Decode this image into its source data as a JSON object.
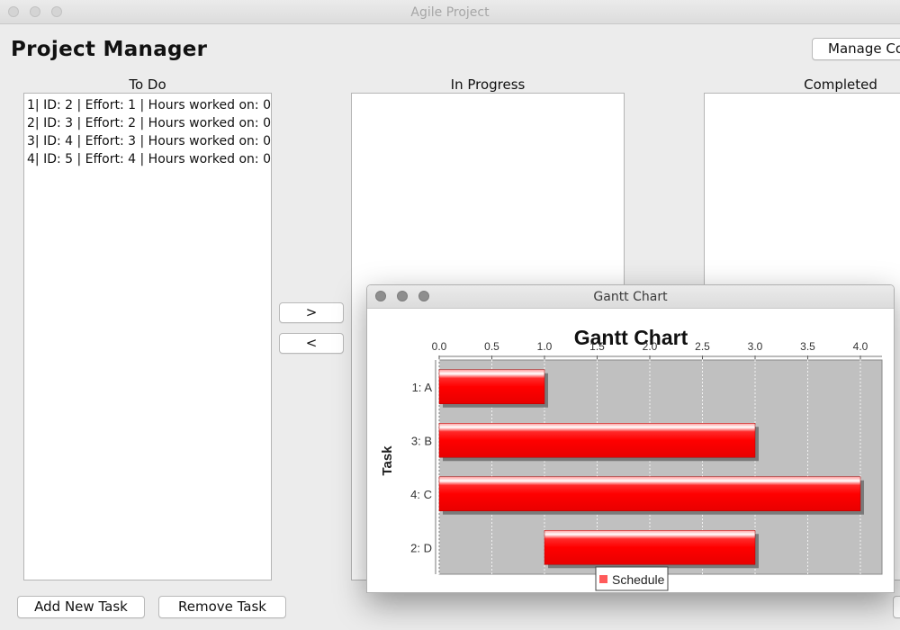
{
  "window": {
    "title": "Agile Project"
  },
  "app": {
    "title": "Project Manager",
    "manage_button": "Manage Co"
  },
  "columns": {
    "todo": {
      "header": "To Do",
      "items": [
        "1| ID: 2 | Effort: 1 | Hours worked on: 0",
        "2| ID: 3 | Effort: 2 | Hours worked on: 0",
        "3| ID: 4 | Effort: 3 | Hours worked on: 0",
        "4| ID: 5 | Effort: 4 | Hours worked on: 0"
      ]
    },
    "in_progress": {
      "header": "In Progress",
      "items": []
    },
    "completed": {
      "header": "Completed",
      "items": []
    }
  },
  "move_buttons": {
    "forward": ">",
    "back": "<"
  },
  "bottom_buttons": {
    "add": "Add New Task",
    "remove": "Remove Task"
  },
  "gantt_window": {
    "title": "Gantt Chart"
  },
  "colors": {
    "bar": "#ff0000",
    "plot_bg": "#c0c0c0",
    "legend_swatch": "#ff5a5a"
  },
  "chart_data": {
    "type": "bar",
    "orientation": "horizontal-gantt",
    "title": "Gantt Chart",
    "ylabel": "Task",
    "xlabel": "",
    "xlim": [
      0,
      4.2
    ],
    "xticks": [
      "0.0",
      "0.5",
      "1.0",
      "1.5",
      "2.0",
      "2.5",
      "3.0",
      "3.5",
      "4.0"
    ],
    "x_axis_position": "top",
    "grid": true,
    "legend": "bottom-center",
    "series": [
      {
        "name": "Schedule",
        "tasks": [
          {
            "label": "1: A",
            "start": 0,
            "end": 1
          },
          {
            "label": "3: B",
            "start": 0,
            "end": 3
          },
          {
            "label": "4: C",
            "start": 0,
            "end": 4
          },
          {
            "label": "2: D",
            "start": 1,
            "end": 3
          }
        ]
      }
    ]
  }
}
